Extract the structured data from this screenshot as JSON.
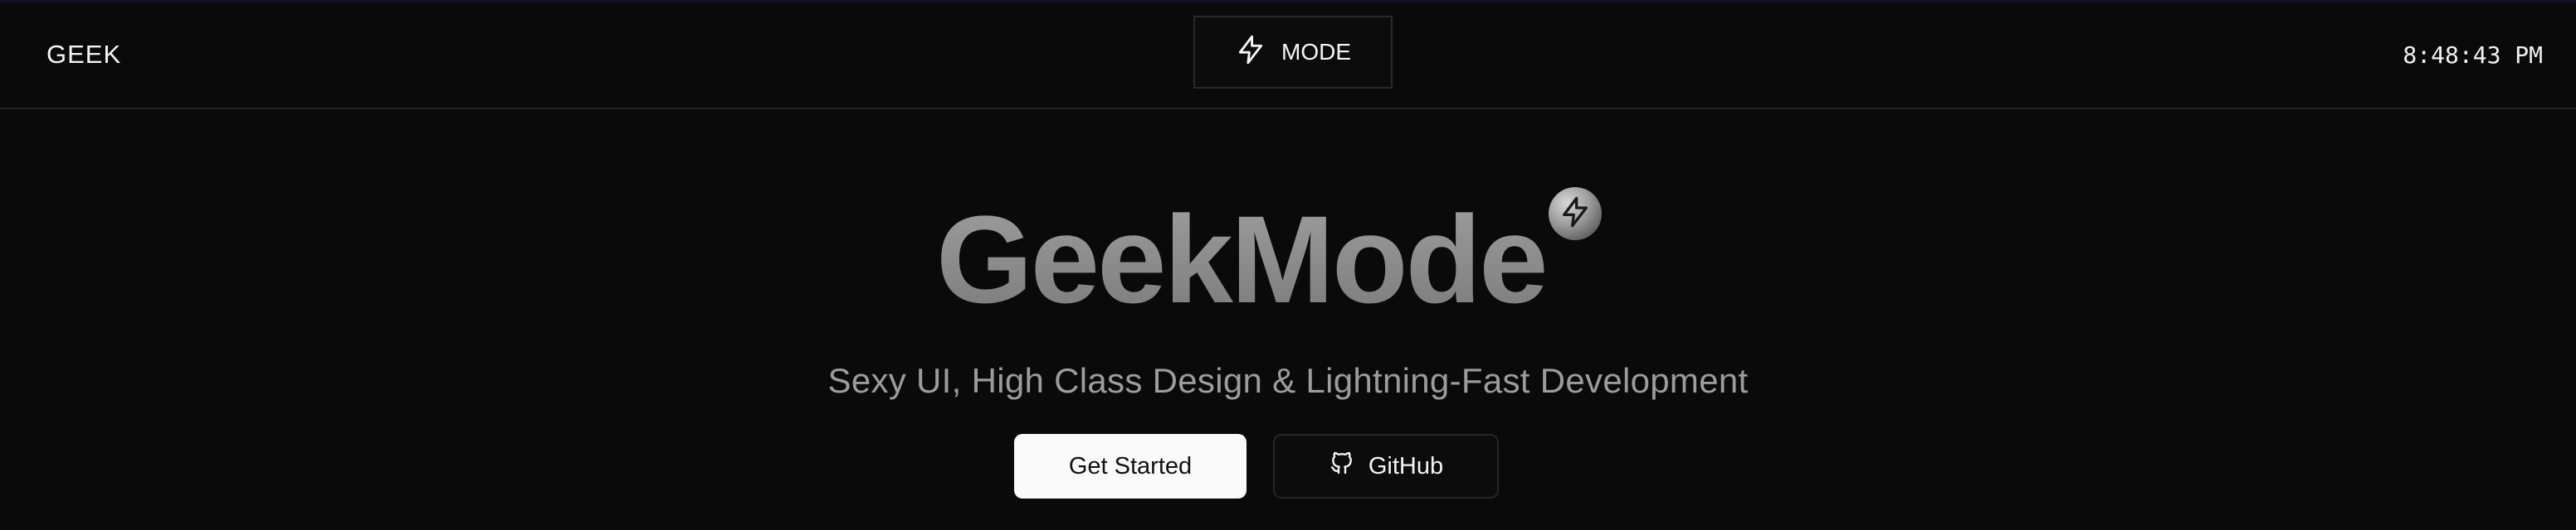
{
  "navbar": {
    "brand": "GEEK",
    "mode_button_label": "MODE",
    "mode_button_icon": "lightning-bolt-icon",
    "clock": "8:48:43 PM"
  },
  "hero": {
    "title": "GeekMode",
    "badge_icon": "lightning-bolt-icon",
    "subtitle": "Sexy UI, High Class Design & Lightning-Fast Development",
    "primary_button": "Get Started",
    "secondary_button": "GitHub",
    "secondary_button_icon": "github-icon"
  },
  "colors": {
    "background": "#0a0a0b",
    "border": "#262626",
    "title_gray": "#8a8a8a",
    "primary_button_bg": "#fafafa"
  }
}
